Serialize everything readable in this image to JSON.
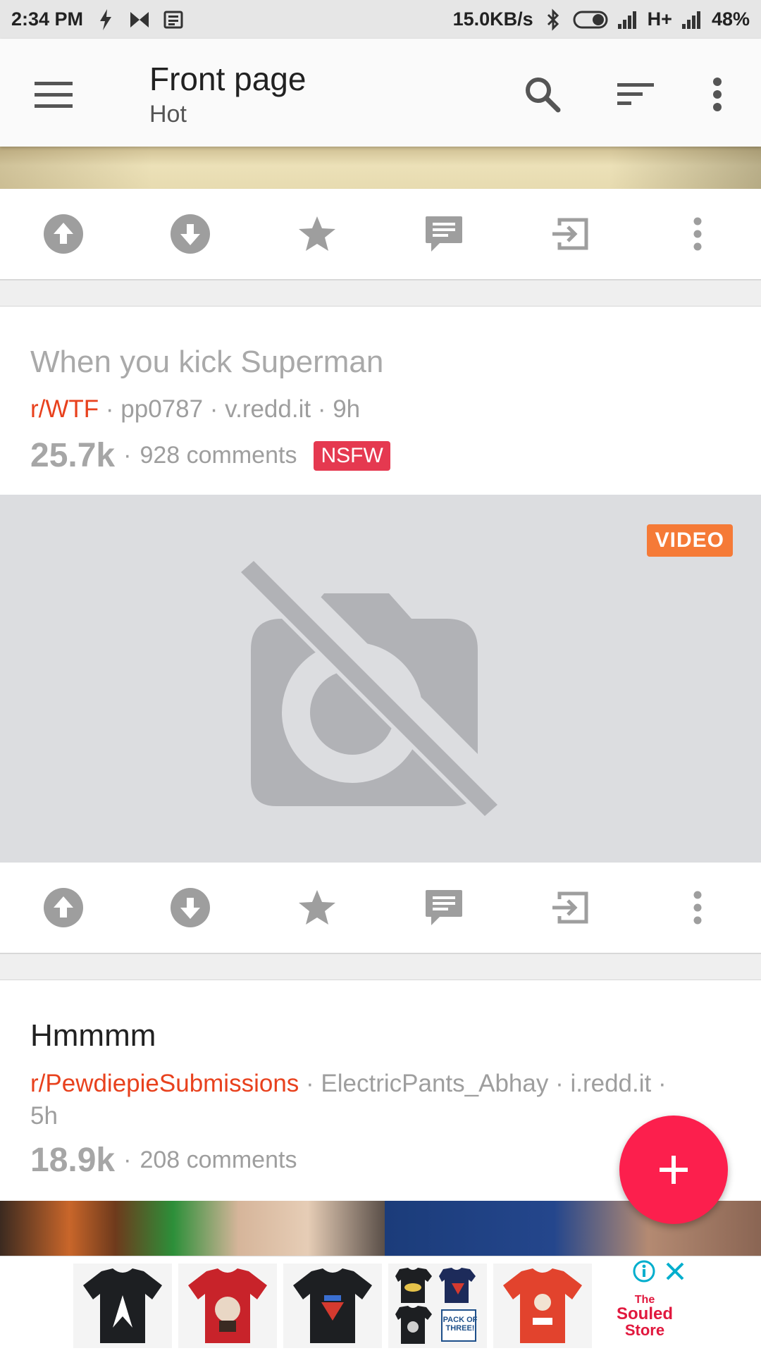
{
  "status_bar": {
    "time": "2:34 PM",
    "speed": "15.0KB/s",
    "network": "H+",
    "battery": "48%"
  },
  "app_bar": {
    "title": "Front page",
    "subtitle": "Hot",
    "icons": [
      "menu-icon",
      "search-icon",
      "sort-icon",
      "more-vert-icon"
    ]
  },
  "action_icons": [
    "upvote-icon",
    "downvote-icon",
    "star-icon",
    "comment-icon",
    "open-icon",
    "more-vert-icon"
  ],
  "posts": [
    {
      "title": "When you kick Superman",
      "subreddit": "r/WTF",
      "meta_rest": " · pp0787 · v.redd.it · 9h",
      "score": "25.7k",
      "comments": "928 comments",
      "nsfw_label": "NSFW",
      "badge": "VIDEO",
      "title_color": "#a9a9a9"
    },
    {
      "title": "Hmmmm",
      "subreddit": "r/PewdiepieSubmissions",
      "meta_rest": " · ElectricPants_Abhay · i.redd.it ·",
      "meta_line2": "5h",
      "score": "18.9k",
      "comments": "208 comments",
      "title_color": "#212121"
    }
  ],
  "fab": {
    "icon": "plus-icon"
  },
  "ad": {
    "brand_line1": "The",
    "brand_line2": "Souled",
    "brand_line3": "Store",
    "pack_label": "PACK OF THREE!",
    "icons": [
      "info-icon",
      "close-icon"
    ]
  },
  "colors": {
    "accent": "#fc1f4d",
    "subreddit": "#e8411d",
    "nsfw": "#e53950",
    "video": "#f57a37"
  }
}
